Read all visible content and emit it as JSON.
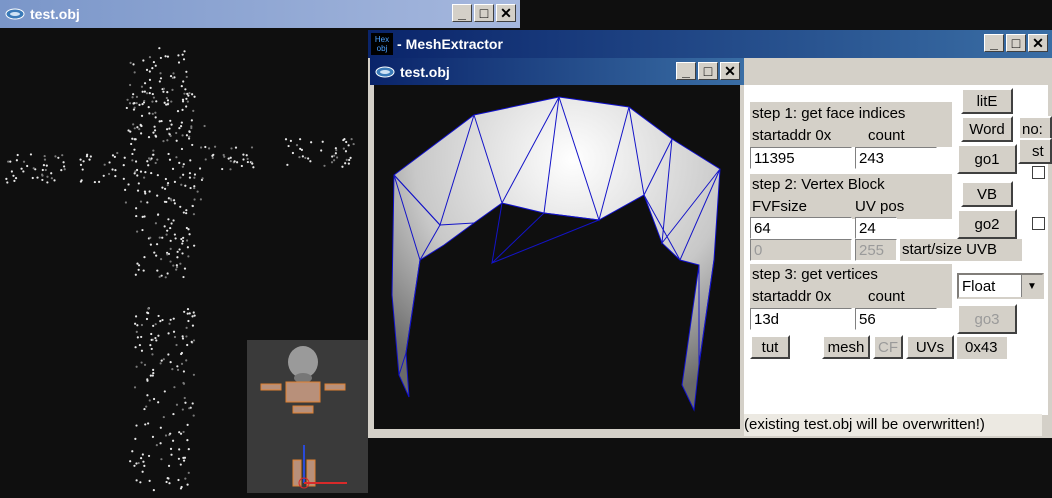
{
  "windows": {
    "bg_viewer": {
      "title": "test.obj"
    },
    "extractor": {
      "title": "MeshExtractor",
      "icon_text": [
        "Hex",
        "obj"
      ]
    },
    "inner_viewer": {
      "title": "test.obj"
    }
  },
  "step1": {
    "heading": "step 1: get face indices",
    "startaddr_label": "startaddr 0x",
    "count_label": "count",
    "startaddr_value": "11395",
    "count_value": "243"
  },
  "step2": {
    "heading": "step 2: Vertex Block",
    "fvf_label": "FVFsize",
    "uvpos_label": "UV pos",
    "fvf_value": "64",
    "uvpos_value": "24",
    "uvb_start_value": "0",
    "uvb_size_value": "255",
    "uvb_label": "start/size UVB"
  },
  "step3": {
    "heading": "step 3: get vertices",
    "startaddr_label": "startaddr 0x",
    "count_label": "count",
    "startaddr_value": "13d",
    "count_value": "56"
  },
  "buttons": {
    "lite": "litE",
    "word": "Word",
    "go1": "go1",
    "vb": "VB",
    "go2": "go2",
    "go3": "go3",
    "tut": "tut",
    "mesh": "mesh",
    "cf": "CF",
    "uvs": "UVs",
    "cut_no": "no:",
    "cut_st": "st"
  },
  "float_select": {
    "value": "Float"
  },
  "hex_value": "0x43",
  "status_text": "(existing test.obj will be overwritten!)"
}
